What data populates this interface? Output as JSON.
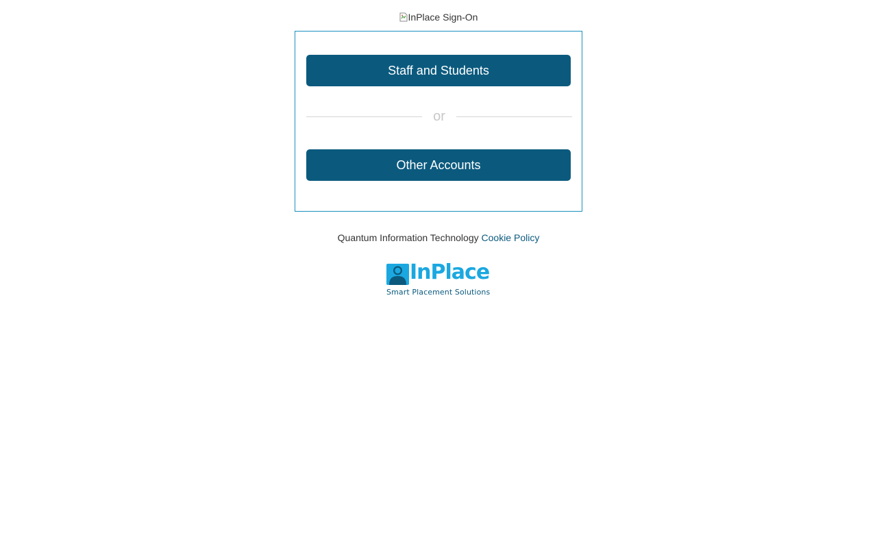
{
  "header": {
    "image_alt": "InPlace Sign-On"
  },
  "signin": {
    "staff_button_label": "Staff and Students",
    "divider_text": "or",
    "other_button_label": "Other Accounts"
  },
  "footer": {
    "company_text": "Quantum Information Technology",
    "cookie_link_label": "Cookie Policy"
  },
  "logo": {
    "wordmark": "InPlace",
    "tagline": "Smart Placement Solutions"
  },
  "colors": {
    "button_bg": "#0b5a7e",
    "card_border": "#1a8fc0",
    "logo_accent": "#1ba8e0",
    "divider": "#d4d4d4"
  },
  "icons": {
    "broken_image": "broken-image-icon",
    "logo_mark": "person-silhouette-icon"
  }
}
